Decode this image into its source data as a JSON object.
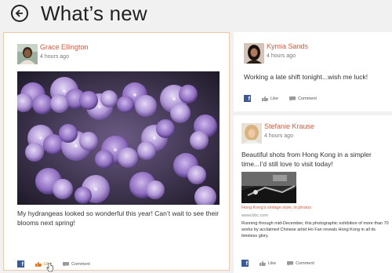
{
  "header": {
    "title": "What’s new",
    "back_icon": "back-arrow-icon"
  },
  "posts": [
    {
      "author": "Grace Ellington",
      "time": "4 hours ago",
      "text": "My hydrangeas looked so wonderful this year! Can’t wait to see their blooms next spring!",
      "photo": "purple-hydrangea-flowers",
      "like_label": "Like",
      "comment_label": "Comment",
      "liked": true
    },
    {
      "author": "Kymia Sands",
      "time": "4 hours ago",
      "text": "Working a late shift tonight...wish me luck!",
      "like_label": "Like",
      "comment_label": "Comment"
    },
    {
      "author": "Stefanie Krause",
      "time": "4 hours ago",
      "text": "Beautiful shots from Hong Kong in a simpler time...I’d still love to visit today!",
      "link": {
        "title": "Hong Kong’s vintage style, in photos",
        "domain": "www.bbc.com",
        "description": "Running through mid-December, this photographic exhibition of more than 70 works by acclaimed Chinese artist Ho Fan reveals Hong Kong in all its timeless glory."
      },
      "like_label": "Like",
      "comment_label": "Comment"
    }
  ],
  "colors": {
    "accent": "#d9573b",
    "like_active": "#e8751a",
    "facebook": "#3b5998",
    "selected_border": "#f2c9a8"
  }
}
